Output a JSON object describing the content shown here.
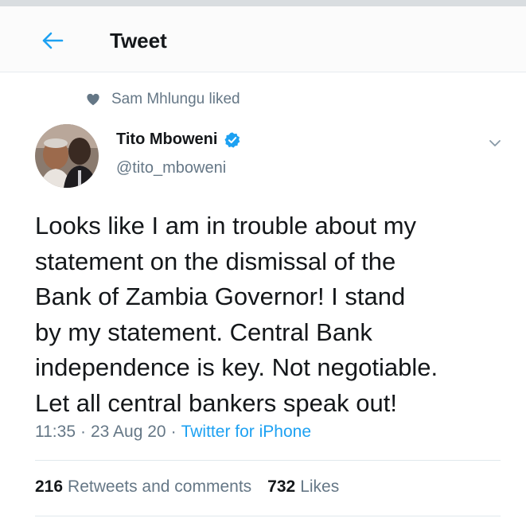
{
  "header": {
    "title": "Tweet"
  },
  "social_context": {
    "text": "Sam Mhlungu liked",
    "icon": "heart-icon"
  },
  "author": {
    "name": "Tito Mboweni",
    "handle": "@tito_mboweni",
    "verified": true
  },
  "tweet": {
    "lines": [
      "Looks like I am in trouble about my",
      "statement on the dismissal of the",
      "Bank of Zambia Governor! I stand",
      "by my statement. Central Bank",
      "independence is key. Not negotiable.",
      "Let all central bankers speak out!"
    ],
    "time": "11:35",
    "date": "23 Aug 20",
    "source": "Twitter for iPhone",
    "separator": "·"
  },
  "stats": {
    "retweets_count": "216",
    "retweets_label": "Retweets and comments",
    "likes_count": "732",
    "likes_label": "Likes"
  },
  "colors": {
    "accent": "#1da1f2",
    "text_primary": "#14171a",
    "text_secondary": "#657786",
    "divider": "#e1e8ed"
  }
}
